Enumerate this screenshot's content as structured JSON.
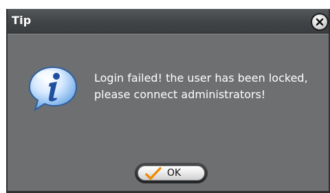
{
  "dialog": {
    "title": "Tip",
    "message": "Login failed! the user has been locked, please connect administrators!",
    "ok_label": "OK",
    "icons": {
      "close": "close-icon",
      "info": "info-icon",
      "check": "checkmark-icon"
    }
  }
}
